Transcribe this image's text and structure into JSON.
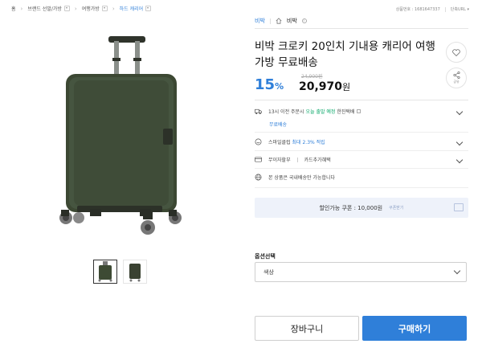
{
  "breadcrumb": {
    "home": "홈",
    "items": [
      "브랜드 선발/가방",
      "여행가방",
      "하드 캐리어"
    ]
  },
  "top_right": {
    "product_number": "상품번호 : 1681647337",
    "shortcut": "단축URL"
  },
  "brand": {
    "name": "비박",
    "store": "비박"
  },
  "product": {
    "title": "비박 크로키 20인치 기내용 캐리어 여행가방 무료배송",
    "original_price": "24,900원",
    "discount_number": "15",
    "discount_unit": "%",
    "price_number": "20,970",
    "price_unit": "원",
    "share_label": "공유"
  },
  "delivery": {
    "text_prefix": "13시 이전 주문시",
    "today": "오늘 출발 예정",
    "method": "한진택배",
    "free": "무료배송"
  },
  "membership": {
    "prefix": "스마일클럽",
    "rate": "최대 2.3% 적립"
  },
  "installment": {
    "label": "무이자할부",
    "card": "카드추가혜택"
  },
  "notice": {
    "text": "본 상품은 국내배송만 가능합니다"
  },
  "coupon": {
    "text": "할인가능 쿠폰 : 10,000원",
    "link": "쿠폰받기"
  },
  "options": {
    "label": "옵션선택",
    "color_placeholder": "색상"
  },
  "buttons": {
    "cart": "장바구니",
    "buy": "구매하기"
  },
  "colors": {
    "accent": "#2f7fd9",
    "suitcase": "#3d4a34"
  }
}
